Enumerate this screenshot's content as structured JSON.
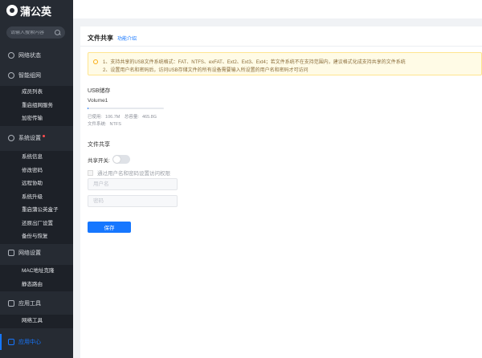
{
  "app": {
    "brand": "蒲公英"
  },
  "search": {
    "placeholder": "请输入搜索内容"
  },
  "sidebar": {
    "groups": [
      {
        "label": "网络状态"
      },
      {
        "label": "智能组网"
      },
      {
        "label": "系统设置"
      },
      {
        "label": "网络设置"
      },
      {
        "label": "应用工具"
      },
      {
        "label": "应用中心"
      }
    ],
    "smart_network_items": [
      "成员列表",
      "重启组网服务",
      "加密传输"
    ],
    "system_items": [
      "系统信息",
      "修改密码",
      "远程协助",
      "系统升级",
      "重启蒲公英盒子",
      "还原出厂设置",
      "备份与恢复"
    ],
    "network_items": [
      "MAC地址克隆",
      "静态路由"
    ],
    "tools_items": [
      "网络工具"
    ]
  },
  "page": {
    "title": "文件共享",
    "help_link": "功能介绍",
    "notice": [
      "1、支持共享的USB文件系统格式：FAT、NTFS、exFAT、Ext2、Ext3、Ext4；若文件系统不在支持范围内，建议格式化成支持共享的文件系统",
      "2、设置用户名和密码后，访问USB存储文件的所有设备需要输入所设置的用户名和密码才可访问"
    ],
    "usb": {
      "title": "USB储存",
      "volume_name": "Volume1",
      "used_label": "已使用:",
      "used_value": "106.7M",
      "capacity_label": "总容量:",
      "capacity_value": "465.8G",
      "fs_label": "文件系统:",
      "fs_value": "NTFS",
      "used_fraction": 0.0002
    },
    "share": {
      "title": "文件共享",
      "switch_label": "共享开关:",
      "switch_on": false,
      "auth_label": "通过用户名和密码设置访问权限",
      "username_placeholder": "用户名",
      "password_placeholder": "密码",
      "save_label": "保存"
    }
  },
  "colors": {
    "accent": "#1677ff",
    "sidebar_bg": "#262b33",
    "notice_bg": "#fffbe6"
  }
}
